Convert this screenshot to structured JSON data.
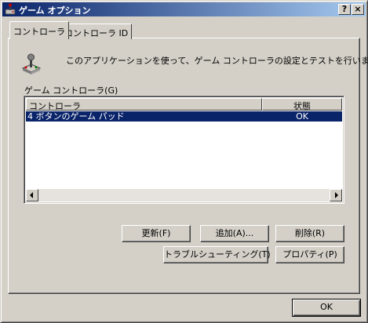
{
  "window": {
    "title": "ゲーム オプション",
    "help_label": "?",
    "close_label": "×"
  },
  "tabs": [
    {
      "label": "コントローラ",
      "active": true
    },
    {
      "label": "コントローラ ID",
      "active": false
    }
  ],
  "description": "このアプリケーションを使って、ゲーム コントローラの設定とテストを行います。",
  "group_label": "ゲーム コントローラ(G)",
  "list": {
    "columns": [
      "コントローラ",
      "状態"
    ],
    "rows": [
      {
        "name": "4 ボタンのゲーム パッド",
        "status": "OK",
        "selected": true
      }
    ]
  },
  "buttons": {
    "update": "更新(F)",
    "add": "追加(A)...",
    "delete": "削除(R)",
    "troubleshoot": "トラブルシューティング(T)",
    "properties": "プロパティ(P)",
    "ok": "OK"
  },
  "colors": {
    "face": "#d4d0c8",
    "selection": "#0a246a",
    "title_start": "#0a246a",
    "title_end": "#a6caf0"
  },
  "icons": {
    "title": "game-controller-icon",
    "content": "joystick-icon"
  }
}
